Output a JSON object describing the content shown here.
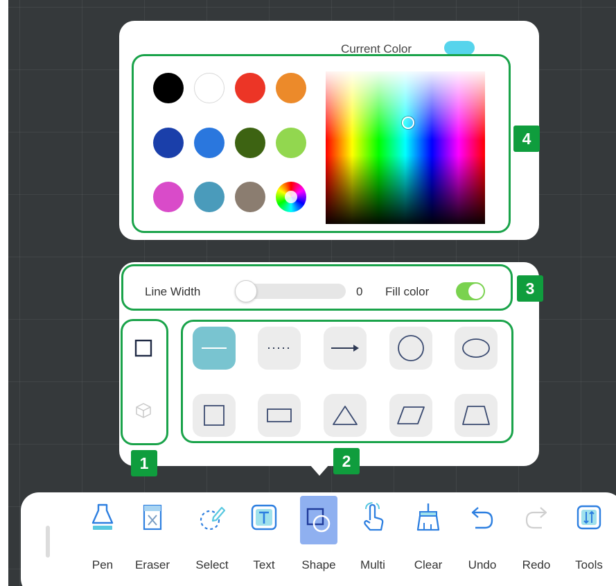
{
  "color_panel": {
    "current_color_label": "Current Color",
    "current_color": "#56d4ec",
    "swatches": [
      {
        "name": "black",
        "color": "#000000"
      },
      {
        "name": "white",
        "color": "#ffffff"
      },
      {
        "name": "red",
        "color": "#ec3526"
      },
      {
        "name": "orange",
        "color": "#ec8a2a"
      },
      {
        "name": "dark-blue",
        "color": "#1a3faa"
      },
      {
        "name": "blue",
        "color": "#2a77de"
      },
      {
        "name": "dark-green",
        "color": "#3d6312"
      },
      {
        "name": "light-green",
        "color": "#92d74f"
      },
      {
        "name": "magenta",
        "color": "#d94bc9"
      },
      {
        "name": "teal",
        "color": "#4a9bbb"
      },
      {
        "name": "taupe",
        "color": "#8b7d70"
      },
      {
        "name": "custom-color-wheel",
        "icon": "color-wheel-icon"
      }
    ]
  },
  "shape_options": {
    "line_width_label": "Line Width",
    "line_width_value": "0",
    "fill_color_label": "Fill color",
    "fill_color_enabled": true,
    "toggle_color": "#7ad24f",
    "shape_types": [
      {
        "icon": "square-2d-icon",
        "selected": true
      },
      {
        "icon": "cube-3d-icon",
        "selected": false
      }
    ],
    "shapes_row1": [
      "solid-line-icon",
      "dotted-line-icon",
      "arrow-line-icon",
      "circle-icon",
      "ellipse-icon"
    ],
    "shapes_row2": [
      "square-icon",
      "rectangle-icon",
      "triangle-icon",
      "parallelogram-icon",
      "trapezoid-icon"
    ],
    "selected_shape": "solid-line-icon"
  },
  "annotations": {
    "badge_1": "1",
    "badge_2": "2",
    "badge_3": "3",
    "badge_4": "4",
    "color": "#1aa34a"
  },
  "toolbar": {
    "accent": "#2d7fe0",
    "tools": [
      {
        "label": "Pen",
        "icon": "pen-icon"
      },
      {
        "label": "Eraser",
        "icon": "eraser-icon"
      },
      {
        "label": "Select",
        "icon": "select-icon"
      },
      {
        "label": "Text",
        "icon": "text-icon"
      },
      {
        "label": "Shape",
        "icon": "shape-icon",
        "active": true
      },
      {
        "label": "Multi",
        "icon": "multi-touch-icon"
      },
      {
        "label": "Clear",
        "icon": "clear-icon"
      },
      {
        "label": "Undo",
        "icon": "undo-icon"
      },
      {
        "label": "Redo",
        "icon": "redo-icon",
        "disabled": true
      },
      {
        "label": "Tools",
        "icon": "tools-icon"
      }
    ]
  }
}
